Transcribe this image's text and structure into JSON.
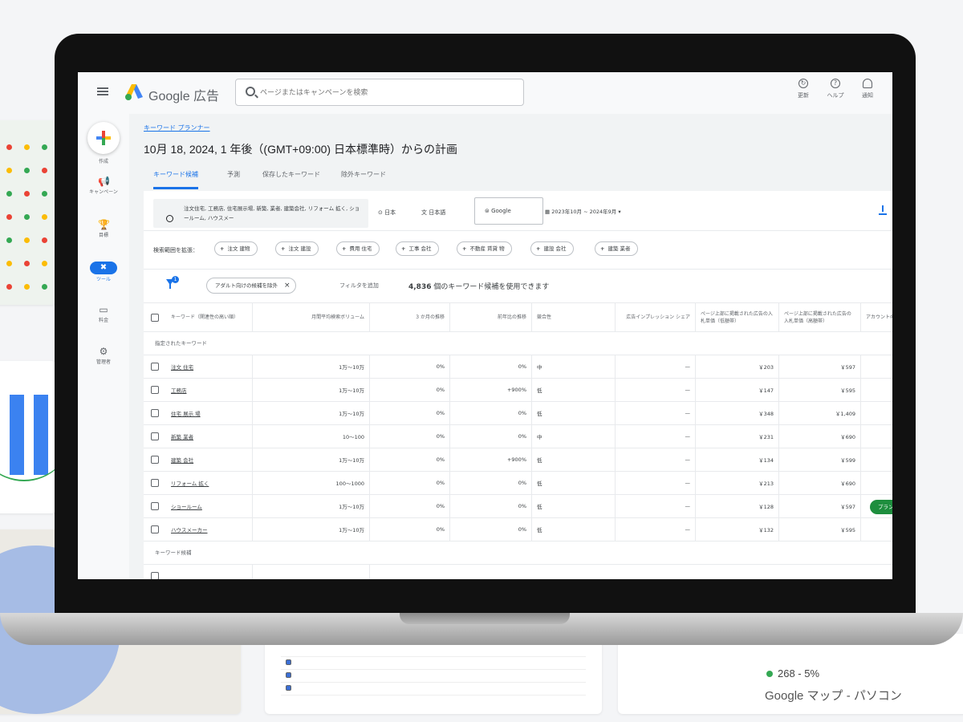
{
  "app": {
    "title": "Google 広告"
  },
  "search": {
    "placeholder": "ページまたはキャンペーンを検索"
  },
  "top_actions": [
    {
      "icon": "refresh-icon",
      "label": "更新"
    },
    {
      "icon": "help-icon",
      "label": "ヘルプ"
    },
    {
      "icon": "bell-icon",
      "label": "通知"
    }
  ],
  "sidenav": {
    "create_label": "作成",
    "items": [
      {
        "icon": "campaign-icon",
        "label": "キャンペーン"
      },
      {
        "icon": "goals-icon",
        "label": "目標"
      },
      {
        "icon": "tools-icon",
        "label": "ツール",
        "active": true
      },
      {
        "icon": "billing-icon",
        "label": "料金"
      },
      {
        "icon": "admin-icon",
        "label": "管理者"
      }
    ]
  },
  "breadcrumb": "キーワード プランナー",
  "page_title": "10月 18, 2024, 1 年後（(GMT+09:00) 日本標準時）からの計画",
  "tabs": [
    {
      "label": "キーワード候補",
      "active": true
    },
    {
      "label": "予測"
    },
    {
      "label": "保存したキーワード"
    },
    {
      "label": "除外キーワード"
    }
  ],
  "filters": {
    "keywords_text": "注文住宅, 工務店, 住宅展示場, 新築, 業者, 建築会社, リフォーム 拡く, ショールーム, ハウスメー",
    "location": "日本",
    "language": "日本語",
    "network": "Google",
    "date_range": "2023年10月 ~ 2024年9月"
  },
  "broaden": {
    "label": "検索範囲を拡張：",
    "chips": [
      "注文 建物",
      "注文 建設",
      "費用 住宅",
      "工事 会社",
      "不動産 賃貸 物",
      "建設 会社",
      "建築 業者"
    ]
  },
  "refine": {
    "filter_badge": "1",
    "adult_chip": "アダルト向けの候補を除外",
    "add_filter": "フィルタを追加",
    "count_value": "4,836",
    "count_suffix": " 個のキーワード候補を使用できます"
  },
  "table": {
    "headers": [
      "キーワード（関連性の高い順）",
      "月間平均検索ボリューム",
      "3 か月の推移",
      "前年比の推移",
      "競合性",
      "広告インプレッション シェア",
      "ページ上部に掲載された広告の入札単価（低額帯）",
      "ページ上部に掲載された広告の入札単価（高額帯）",
      "アカウントのステータス"
    ],
    "section_provided": "指定されたキーワード",
    "section_ideas": "キーワード候補",
    "rows": [
      {
        "keyword": "注文 住宅",
        "volume": "1万～10万",
        "three_month": "0%",
        "yoy": "0%",
        "competition": "中",
        "share": "—",
        "bid_low": "￥203",
        "bid_high": "￥597"
      },
      {
        "keyword": "工務店",
        "volume": "1万～10万",
        "three_month": "0%",
        "yoy": "+900%",
        "competition": "低",
        "share": "—",
        "bid_low": "￥147",
        "bid_high": "￥595"
      },
      {
        "keyword": "住宅 展示 場",
        "volume": "1万～10万",
        "three_month": "0%",
        "yoy": "0%",
        "competition": "低",
        "share": "—",
        "bid_low": "￥348",
        "bid_high": "￥1,409"
      },
      {
        "keyword": "新築 業者",
        "volume": "10～100",
        "three_month": "0%",
        "yoy": "0%",
        "competition": "中",
        "share": "—",
        "bid_low": "￥231",
        "bid_high": "￥690"
      },
      {
        "keyword": "建築 会社",
        "volume": "1万～10万",
        "three_month": "0%",
        "yoy": "+900%",
        "competition": "低",
        "share": "—",
        "bid_low": "￥134",
        "bid_high": "￥599"
      },
      {
        "keyword": "リフォーム 拡く",
        "volume": "100～1000",
        "three_month": "0%",
        "yoy": "0%",
        "competition": "低",
        "share": "—",
        "bid_low": "￥213",
        "bid_high": "￥690"
      },
      {
        "keyword": "ショールーム",
        "volume": "1万～10万",
        "three_month": "0%",
        "yoy": "0%",
        "competition": "低",
        "share": "—",
        "bid_low": "￥128",
        "bid_high": "￥597"
      },
      {
        "keyword": "ハウスメーカー",
        "volume": "1万～10万",
        "three_month": "0%",
        "yoy": "0%",
        "competition": "低",
        "share": "—",
        "bid_low": "￥132",
        "bid_high": "￥595"
      }
    ],
    "add_plan_label": "プラン"
  },
  "background": {
    "stat_text": "268 - 5%",
    "stat_sub": "Google マップ - パソコン"
  },
  "colors": {
    "accent": "#1a73e8",
    "success": "#1e8e3e",
    "google_red": "#ea4335",
    "google_yellow": "#fbbc04",
    "google_green": "#34a853"
  }
}
